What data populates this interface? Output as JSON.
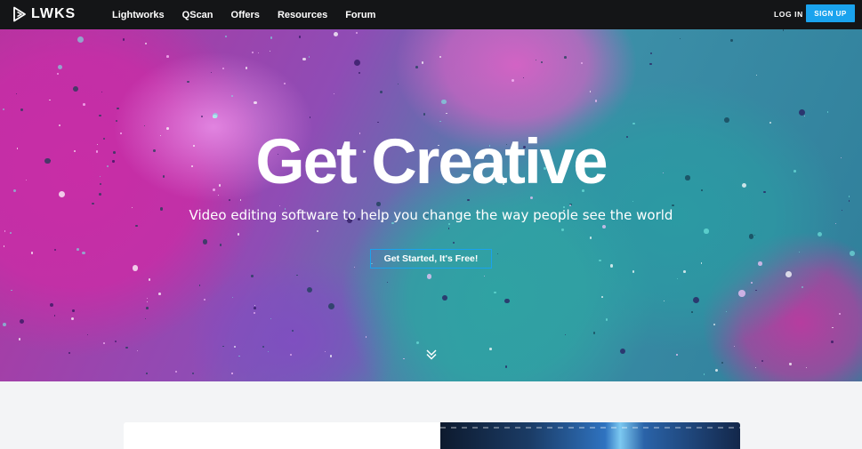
{
  "nav": {
    "brand": "LWKS",
    "links": [
      "Lightworks",
      "QScan",
      "Offers",
      "Resources",
      "Forum"
    ],
    "login_label": "LOG IN",
    "signup_label": "SIGN UP"
  },
  "hero": {
    "title": "Get Creative",
    "subtitle": "Video editing software to help you change the way people see the world",
    "cta_label": "Get Started, It's Free!",
    "scroll_icon": "double-chevron-down-icon"
  },
  "colors": {
    "nav_bg": "#141517",
    "accent": "#1aa3ee",
    "page_bg": "#f3f4f6"
  }
}
